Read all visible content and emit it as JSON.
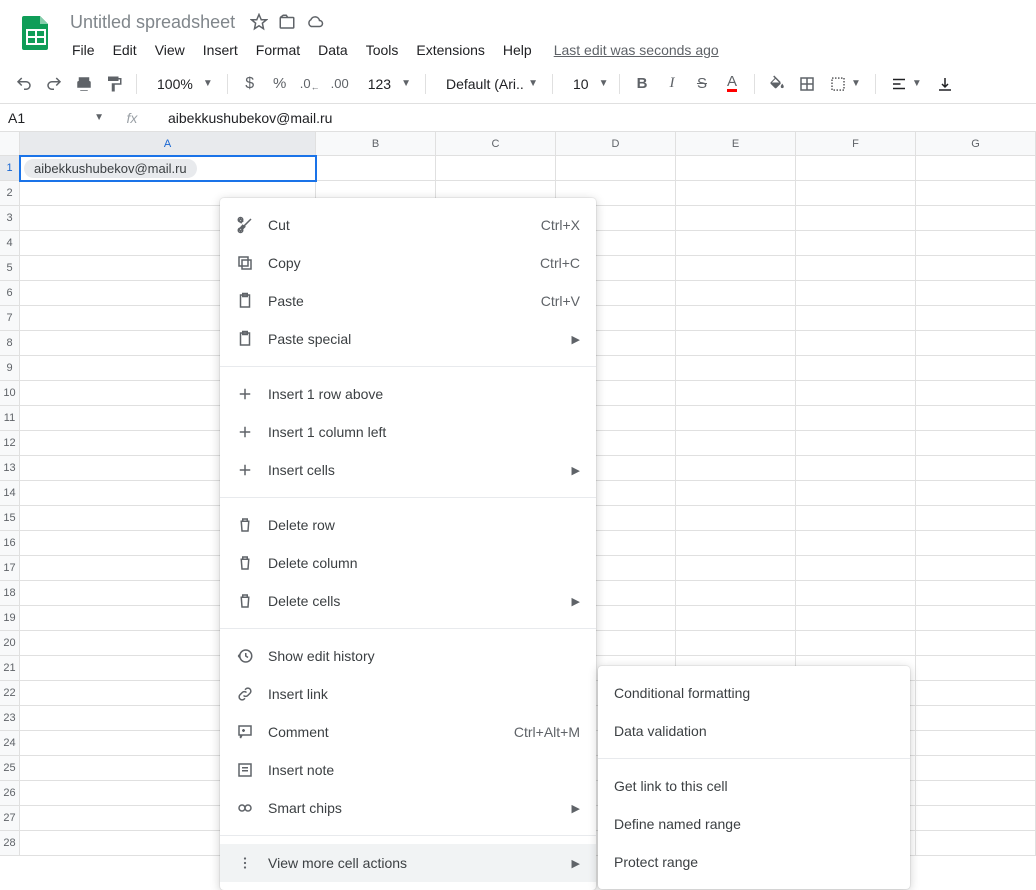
{
  "header": {
    "title": "Untitled spreadsheet",
    "last_edit": "Last edit was seconds ago"
  },
  "menus": [
    "File",
    "Edit",
    "View",
    "Insert",
    "Format",
    "Data",
    "Tools",
    "Extensions",
    "Help"
  ],
  "toolbar": {
    "zoom": "100%",
    "font": "Default (Ari...",
    "font_size": "10"
  },
  "namebox": {
    "ref": "A1"
  },
  "formula_bar": {
    "value": "aibekkushubekov@mail.ru"
  },
  "columns": [
    "A",
    "B",
    "C",
    "D",
    "E",
    "F",
    "G"
  ],
  "rows": 28,
  "selected_col": "A",
  "selected_row": 1,
  "cells": {
    "A1": "aibekkushubekov@mail.ru"
  },
  "context_menu": [
    {
      "icon": "cut",
      "label": "Cut",
      "shortcut": "Ctrl+X"
    },
    {
      "icon": "copy",
      "label": "Copy",
      "shortcut": "Ctrl+C"
    },
    {
      "icon": "paste",
      "label": "Paste",
      "shortcut": "Ctrl+V"
    },
    {
      "icon": "paste",
      "label": "Paste special",
      "submenu": true
    },
    {
      "sep": true
    },
    {
      "icon": "plus",
      "label": "Insert 1 row above"
    },
    {
      "icon": "plus",
      "label": "Insert 1 column left"
    },
    {
      "icon": "plus",
      "label": "Insert cells",
      "submenu": true
    },
    {
      "sep": true
    },
    {
      "icon": "trash",
      "label": "Delete row"
    },
    {
      "icon": "trash",
      "label": "Delete column"
    },
    {
      "icon": "trash",
      "label": "Delete cells",
      "submenu": true
    },
    {
      "sep": true
    },
    {
      "icon": "history",
      "label": "Show edit history"
    },
    {
      "icon": "link",
      "label": "Insert link"
    },
    {
      "icon": "comment",
      "label": "Comment",
      "shortcut": "Ctrl+Alt+M"
    },
    {
      "icon": "note",
      "label": "Insert note"
    },
    {
      "icon": "chip",
      "label": "Smart chips",
      "submenu": true
    },
    {
      "sep": true
    },
    {
      "icon": "more",
      "label": "View more cell actions",
      "submenu": true,
      "hover": true
    }
  ],
  "submenu": [
    {
      "label": "Conditional formatting"
    },
    {
      "label": "Data validation"
    },
    {
      "sep": true
    },
    {
      "label": "Get link to this cell"
    },
    {
      "label": "Define named range"
    },
    {
      "label": "Protect range"
    }
  ]
}
